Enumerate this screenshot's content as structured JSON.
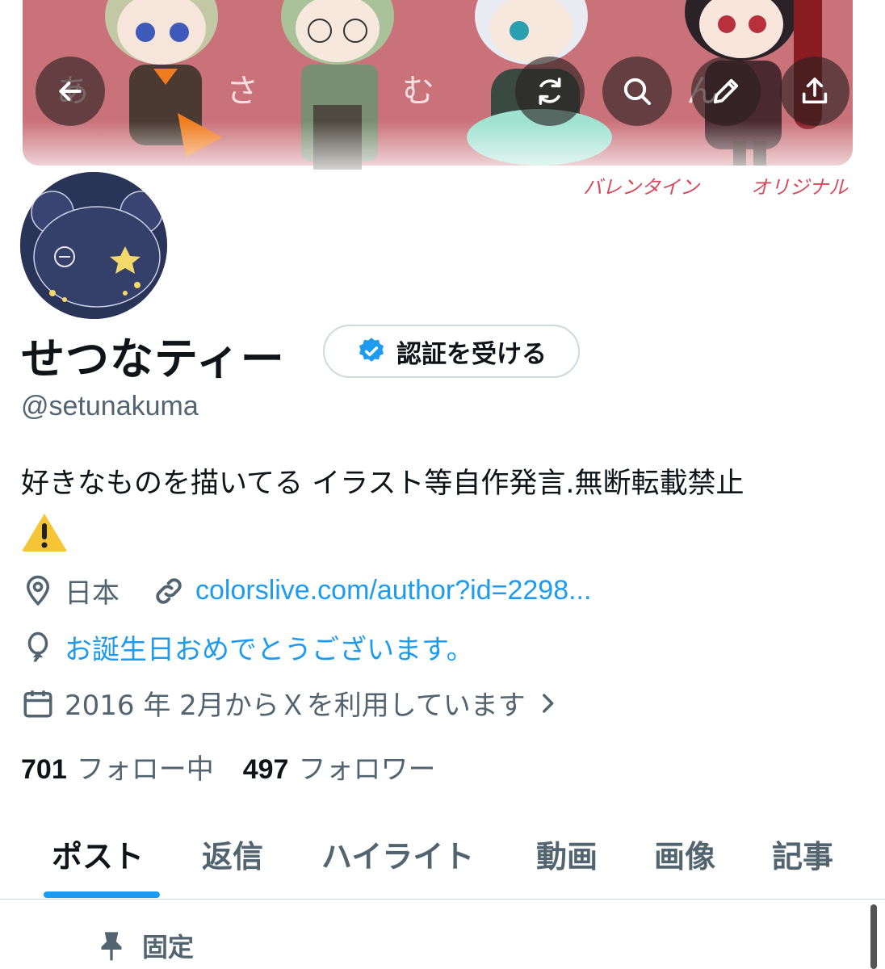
{
  "banner": {
    "kana": [
      "あ",
      "さ",
      "む",
      "ん"
    ],
    "caption_left": "バレンタイン",
    "caption_right": "オリジナル"
  },
  "toolbar": {
    "back_icon": "arrow-left-icon",
    "refresh_icon": "refresh-icon",
    "search_icon": "search-icon",
    "edit_icon": "pencil-icon",
    "share_icon": "share-icon"
  },
  "profile": {
    "display_name": "せつなティー",
    "verify_label": "認証を受ける",
    "handle": "@setunakuma",
    "bio": "好きなものを描いてる イラスト等自作発言.無断転載禁止",
    "location": "日本",
    "link": "colorslive.com/author?id=2298...",
    "birthday": "お誕生日おめでとうございます。",
    "joined": "2016 年 2月からＸを利用しています"
  },
  "stats": {
    "following_count": "701",
    "following_label": "フォロー中",
    "followers_count": "497",
    "followers_label": "フォロワー"
  },
  "tabs": [
    "ポスト",
    "返信",
    "ハイライト",
    "動画",
    "画像",
    "記事"
  ],
  "pinned_label": "固定",
  "colors": {
    "accent": "#1d9bf0",
    "secondary_text": "#536471",
    "banner_bg": "#c9727a"
  }
}
